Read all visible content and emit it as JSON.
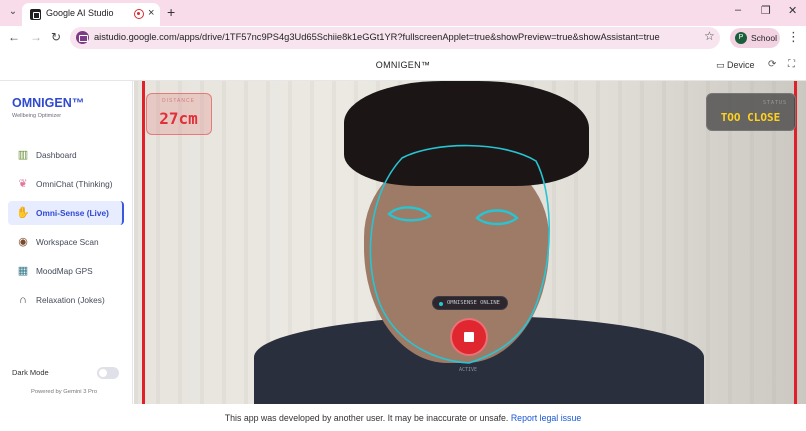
{
  "browser": {
    "tab": {
      "title": "Google AI Studio",
      "close_glyph": "×"
    },
    "new_tab_glyph": "+",
    "window_controls": {
      "minimize": "–",
      "restore": "❐",
      "close": "✕"
    },
    "nav": {
      "back": "←",
      "forward": "→",
      "reload": "↻"
    },
    "url": "aistudio.google.com/apps/drive/1TF57nc9PS4g3Ud65Schiie8k1eGGt1YR?fullscreenApplet=true&showPreview=true&showAssistant=true",
    "profile": {
      "initial": "P",
      "label": "School"
    },
    "star_glyph": "☆",
    "menu_glyph": "⋮"
  },
  "app_header": {
    "title": "OMNIGEN™",
    "device_label": "Device",
    "icons": [
      "device-icon",
      "refresh-icon",
      "fullscreen-icon"
    ]
  },
  "sidebar": {
    "brand": "OMNIGEN™",
    "subtitle": "Wellbeing Optimizer",
    "items": [
      {
        "label": "Dashboard",
        "icon": "chart-icon",
        "glyph": "▥",
        "color": "#6b8f3a"
      },
      {
        "label": "OmniChat (Thinking)",
        "icon": "brain-icon",
        "glyph": "❦",
        "color": "#e07a9a"
      },
      {
        "label": "Omni-Sense (Live)",
        "icon": "hand-icon",
        "glyph": "✋",
        "color": "#3d4a66",
        "active": true
      },
      {
        "label": "Workspace Scan",
        "icon": "eye-icon",
        "glyph": "◉",
        "color": "#7a4a2a"
      },
      {
        "label": "MoodMap GPS",
        "icon": "map-icon",
        "glyph": "▦",
        "color": "#3a7a8a"
      },
      {
        "label": "Relaxation (Jokes)",
        "icon": "headphones-icon",
        "glyph": "∩",
        "color": "#444"
      }
    ],
    "dark_mode_label": "Dark Mode",
    "dark_mode_on": false,
    "powered_by": "Powered by Gemini 3 Pro"
  },
  "camera_view": {
    "distance": {
      "label": "DISTANCE",
      "value": "27cm"
    },
    "status": {
      "label": "STATUS",
      "value": "TOO CLOSE"
    },
    "pill_label": "OMNISENSE ONLINE",
    "active_label": "ACTIVE",
    "colors": {
      "alert": "#e0202a",
      "mesh": "#27c5d4",
      "status_text": "#ffd21f"
    }
  },
  "footer": {
    "text": "This app was developed by another user. It may be inaccurate or unsafe.",
    "link": "Report legal issue"
  }
}
